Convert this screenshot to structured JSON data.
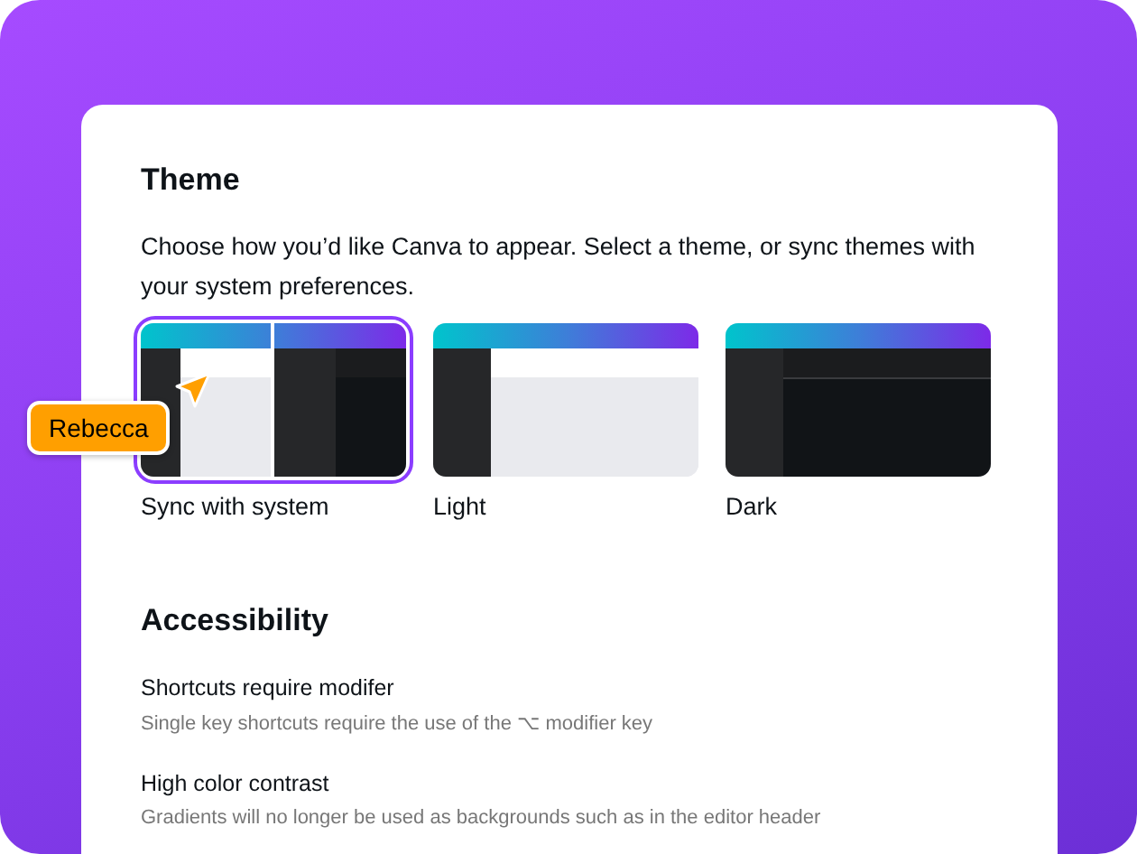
{
  "theme": {
    "title": "Theme",
    "description": "Choose how you’d like Canva to appear. Select a theme, or sync themes with your system preferences.",
    "options": [
      {
        "kind": "sync",
        "label": "Sync with system",
        "selected": true
      },
      {
        "kind": "light",
        "label": "Light",
        "selected": false
      },
      {
        "kind": "dark",
        "label": "Dark",
        "selected": false
      }
    ]
  },
  "collaborator": {
    "name": "Rebecca"
  },
  "accessibility": {
    "title": "Accessibility",
    "items": [
      {
        "title": "Shortcuts require modifer",
        "description": "Single key shortcuts require the use of the ⌥ modifier key"
      },
      {
        "title": "High color contrast",
        "description": "Gradients will no longer be used as backgrounds such as in the editor header"
      }
    ]
  }
}
